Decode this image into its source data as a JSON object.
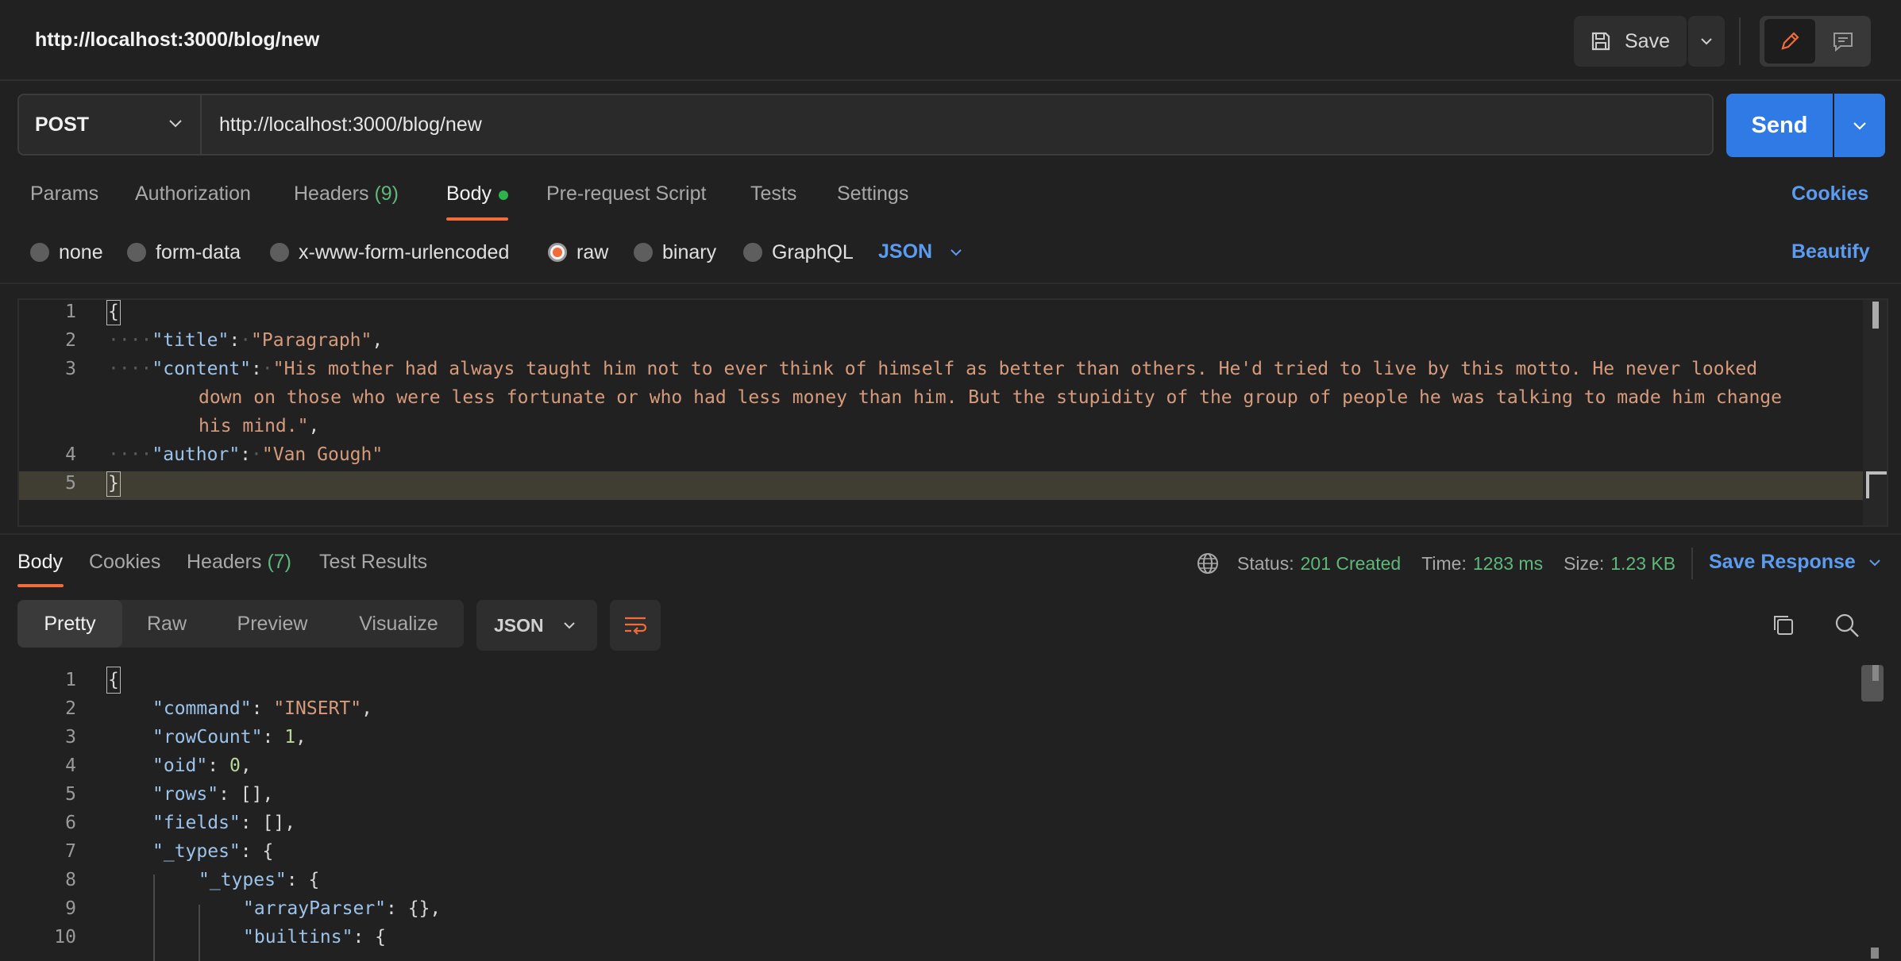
{
  "header": {
    "title": "http://localhost:3000/blog/new",
    "save_label": "Save"
  },
  "request": {
    "method": "POST",
    "url": "http://localhost:3000/blog/new",
    "send_label": "Send",
    "tabs": {
      "params": "Params",
      "authorization": "Authorization",
      "headers": "Headers",
      "headers_count": "(9)",
      "body": "Body",
      "prerequest": "Pre-request Script",
      "tests": "Tests",
      "settings": "Settings"
    },
    "cookies_label": "Cookies",
    "body_types": {
      "none": "none",
      "form_data": "form-data",
      "urlencoded": "x-www-form-urlencoded",
      "raw": "raw",
      "binary": "binary",
      "graphql": "GraphQL"
    },
    "selected_body_type": "raw",
    "raw_format": "JSON",
    "beautify_label": "Beautify",
    "editor": {
      "line_numbers": [
        "1",
        "2",
        "3",
        "",
        "",
        "4",
        "5"
      ],
      "open_brace": "{",
      "close_brace": "}",
      "title_key": "\"title\"",
      "title_val": "\"Paragraph\"",
      "content_key": "\"content\"",
      "content_val_1": "\"His mother had always taught him not to ever think of himself as better than others. He'd tried to live by this motto. He never looked",
      "content_val_2": "down on those who were less fortunate or who had less money than him. But the stupidity of the group of people he was talking to made him change",
      "content_val_3": "his mind.\"",
      "author_key": "\"author\"",
      "author_val": "\"Van Gough\""
    }
  },
  "response": {
    "tabs": {
      "body": "Body",
      "cookies": "Cookies",
      "headers": "Headers",
      "headers_count": "(7)",
      "test_results": "Test Results"
    },
    "status_label": "Status:",
    "status_value": "201 Created",
    "time_label": "Time:",
    "time_value": "1283 ms",
    "size_label": "Size:",
    "size_value": "1.23 KB",
    "save_response_label": "Save Response",
    "views": {
      "pretty": "Pretty",
      "raw": "Raw",
      "preview": "Preview",
      "visualize": "Visualize"
    },
    "format": "JSON",
    "editor": {
      "line_numbers": [
        "1",
        "2",
        "3",
        "4",
        "5",
        "6",
        "7",
        "8",
        "9",
        "10"
      ],
      "open_brace": "{",
      "command_key": "\"command\"",
      "command_val": "\"INSERT\"",
      "rowcount_key": "\"rowCount\"",
      "rowcount_val": "1",
      "oid_key": "\"oid\"",
      "oid_val": "0",
      "rows_key": "\"rows\"",
      "rows_val": "[]",
      "fields_key": "\"fields\"",
      "fields_val": "[]",
      "types_key": "\"_types\"",
      "types2_key": "\"_types\"",
      "arrayparser_key": "\"arrayParser\"",
      "arrayparser_val": "{}",
      "builtins_key": "\"builtins\""
    }
  },
  "colors": {
    "accent_orange": "#f26b3a",
    "link_blue": "#5b9cf0",
    "send_blue": "#2f7ae5",
    "success_green": "#5fb87a"
  }
}
